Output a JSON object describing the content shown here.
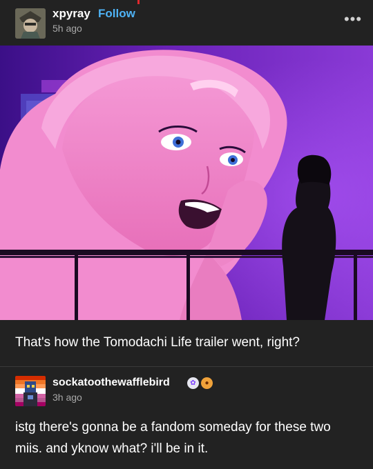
{
  "post": {
    "username": "xpyray",
    "follow_label": "Follow",
    "time": "5h ago",
    "more_label": "•••",
    "caption": "That's how the Tomodachi Life trailer went, right?"
  },
  "reblog": {
    "username": "sockatoothewafflebird",
    "time": "3h ago",
    "text": "istg there's gonna be a fandom someday for these two miis. and yknow what? i'll be in it.",
    "badges": [
      "flower-badge-icon",
      "paw-badge-icon"
    ]
  },
  "colors": {
    "background": "#222222",
    "follow_link": "#4fb3f6",
    "secondary_text": "#a8a8a8",
    "artwork_purple": "#5e1fa8",
    "artwork_pink": "#f27fc6"
  }
}
